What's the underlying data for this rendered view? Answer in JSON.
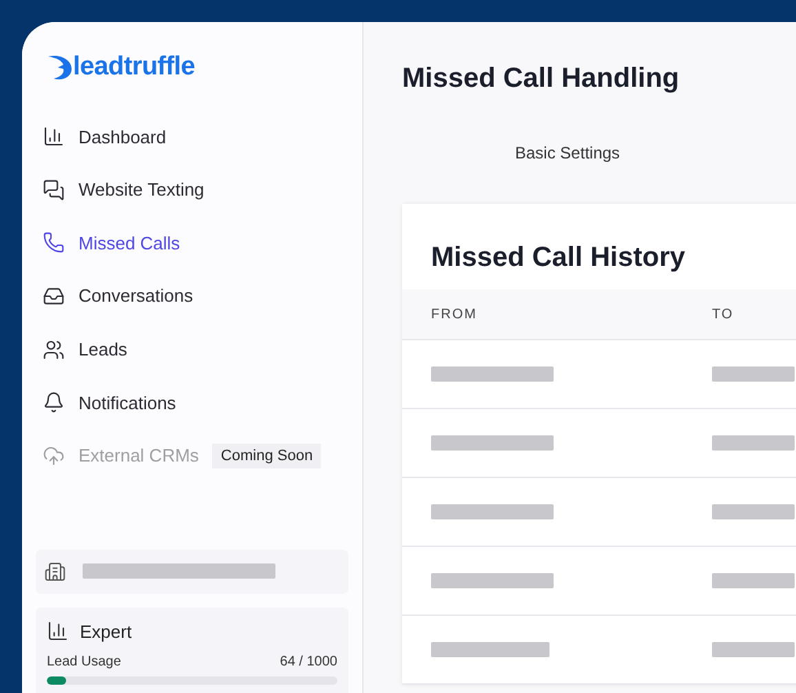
{
  "logo": {
    "text": "leadtruffle"
  },
  "sidebar": {
    "items": [
      {
        "kind": "dashboard",
        "label": "Dashboard",
        "selected": false,
        "disabled": false
      },
      {
        "kind": "texting",
        "label": "Website Texting",
        "selected": false,
        "disabled": false
      },
      {
        "kind": "calls",
        "label": "Missed Calls",
        "selected": true,
        "disabled": false
      },
      {
        "kind": "conversations",
        "label": "Conversations",
        "selected": false,
        "disabled": false
      },
      {
        "kind": "leads",
        "label": "Leads",
        "selected": false,
        "disabled": false
      },
      {
        "kind": "notifications",
        "label": "Notifications",
        "selected": false,
        "disabled": false
      },
      {
        "kind": "crm",
        "label": "External CRMs",
        "selected": false,
        "disabled": true,
        "badge": "Coming Soon"
      }
    ]
  },
  "plan": {
    "name": "Expert",
    "usage_label": "Lead Usage",
    "usage": "64 / 1000",
    "level": 0.064
  },
  "page": {
    "title": "Missed Call Handling",
    "tabs": [
      {
        "label": "Basic Settings",
        "selected": false
      }
    ]
  },
  "table": {
    "title": "Missed Call History",
    "columns": [
      "FROM",
      "TO"
    ],
    "rows": [
      {
        "kind": "redacted"
      },
      {
        "kind": "redacted"
      },
      {
        "kind": "redacted"
      },
      {
        "kind": "redacted"
      },
      {
        "kind": "redacted"
      }
    ]
  }
}
